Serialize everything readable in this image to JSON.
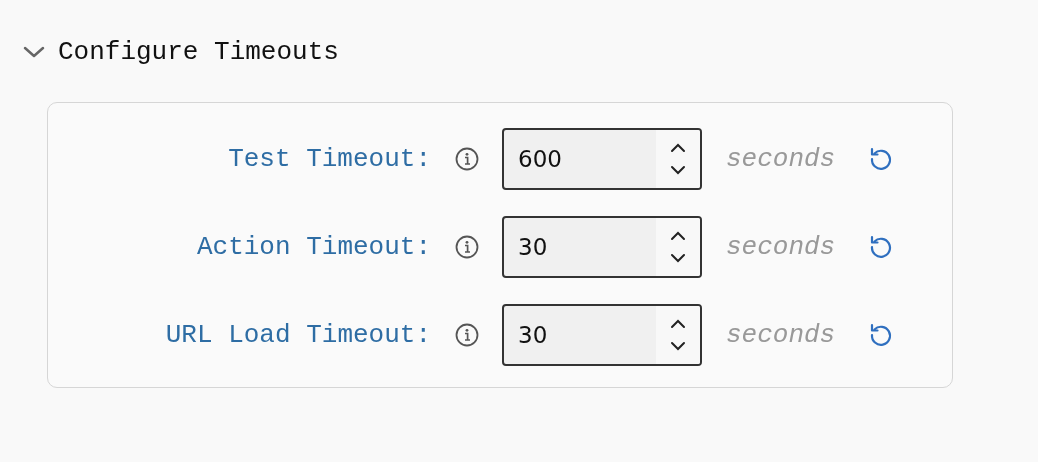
{
  "section": {
    "title": "Configure Timeouts",
    "expanded": true
  },
  "fields": [
    {
      "label": "Test Timeout:",
      "value": "600",
      "unit": "seconds"
    },
    {
      "label": "Action Timeout:",
      "value": "30",
      "unit": "seconds"
    },
    {
      "label": "URL Load Timeout:",
      "value": "30",
      "unit": "seconds"
    }
  ]
}
